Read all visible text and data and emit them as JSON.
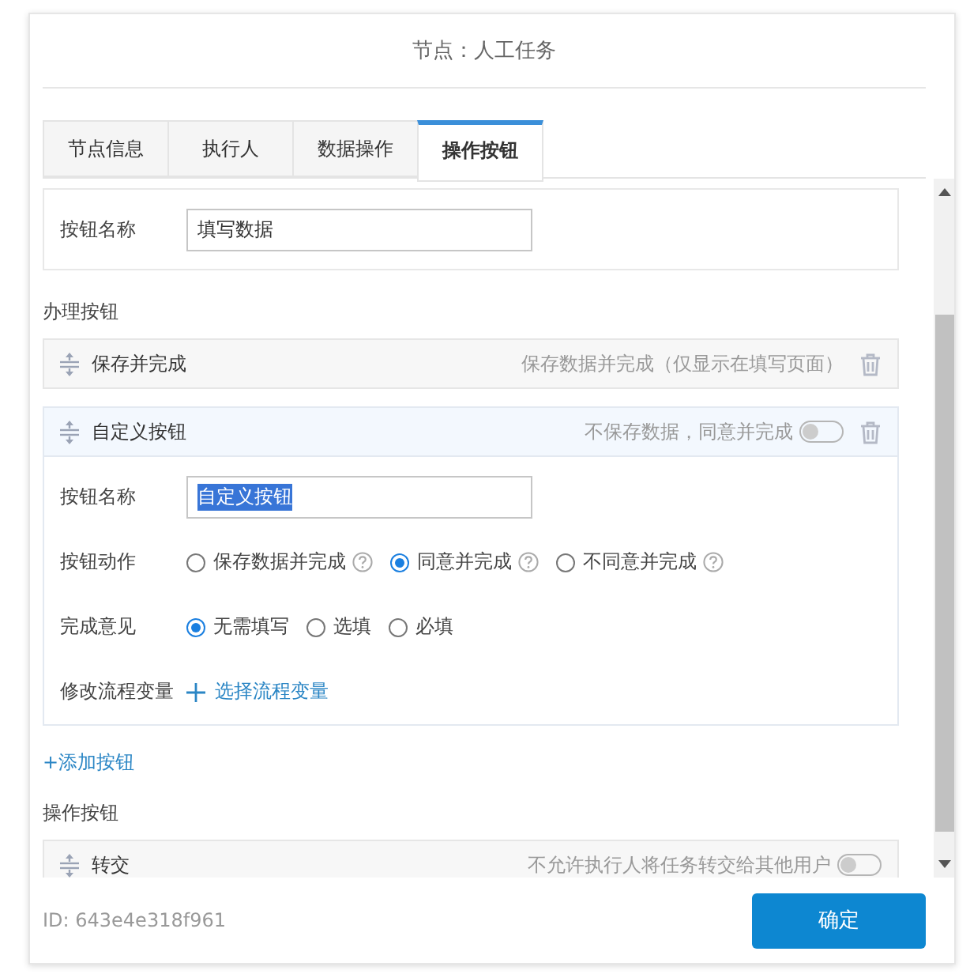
{
  "dialog": {
    "title": "节点：人工任务"
  },
  "tabs": [
    {
      "label": "节点信息",
      "selected": false
    },
    {
      "label": "执行人",
      "selected": false
    },
    {
      "label": "数据操作",
      "selected": false
    },
    {
      "label": "操作按钮",
      "selected": true
    }
  ],
  "button_name": {
    "label": "按钮名称",
    "value": "填写数据"
  },
  "sections": [
    {
      "heading": "办理按钮",
      "buttons": [
        {
          "name": "保存并完成",
          "description": "保存数据并完成（仅显示在填写页面）",
          "deletable": true,
          "expanded": false
        },
        {
          "name": "自定义按钮",
          "description": "不保存数据，同意并完成",
          "toggle_on": false,
          "deletable": true,
          "expanded": true,
          "name_field": {
            "label": "按钮名称",
            "value": "自定义按钮",
            "text_selected": true
          },
          "radio_groups": [
            {
              "label": "按钮动作",
              "options": [
                {
                  "label": "保存数据并完成",
                  "selected": false,
                  "help": true
                },
                {
                  "label": "同意并完成",
                  "selected": true,
                  "help": true
                },
                {
                  "label": "不同意并完成",
                  "selected": false,
                  "help": true
                }
              ]
            },
            {
              "label": "完成意见",
              "options": [
                {
                  "label": "无需填写",
                  "selected": true,
                  "help": false
                },
                {
                  "label": "选填",
                  "selected": false,
                  "help": false
                },
                {
                  "label": "必填",
                  "selected": false,
                  "help": false
                }
              ]
            }
          ],
          "variable": {
            "label": "修改流程变量",
            "link": "选择流程变量"
          }
        }
      ],
      "add_link": "+添加按钮"
    },
    {
      "heading": "操作按钮",
      "buttons": [
        {
          "name": "转交",
          "description": "不允许执行人将任务转交给其他用户",
          "toggle_on": false,
          "deletable": false,
          "expanded": false
        }
      ]
    }
  ],
  "footer": {
    "id": "ID: 643e4e318f961",
    "confirm": "确定"
  }
}
